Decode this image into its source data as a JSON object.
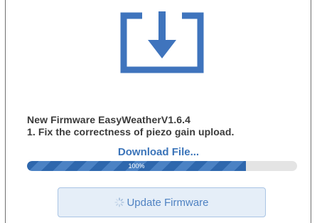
{
  "firmware": {
    "title": "New Firmware EasyWeatherV1.6.4",
    "note": "1. Fix the correctness of piezo gain upload."
  },
  "download": {
    "label": "Download File...",
    "progress_text": "100%",
    "progress_fraction": 0.81
  },
  "update_button": {
    "label": "Update Firmware",
    "state": "loading"
  },
  "icons": {
    "main": "download-tray-icon",
    "spinner": "loading-spinner-icon"
  },
  "colors": {
    "accent": "#3b74b9",
    "icon": "#3f74bd",
    "progress_fill": "#2e67ad",
    "progress_track": "#e4e4e4",
    "button_bg": "#e5eef8",
    "text": "#3a3a3a"
  }
}
